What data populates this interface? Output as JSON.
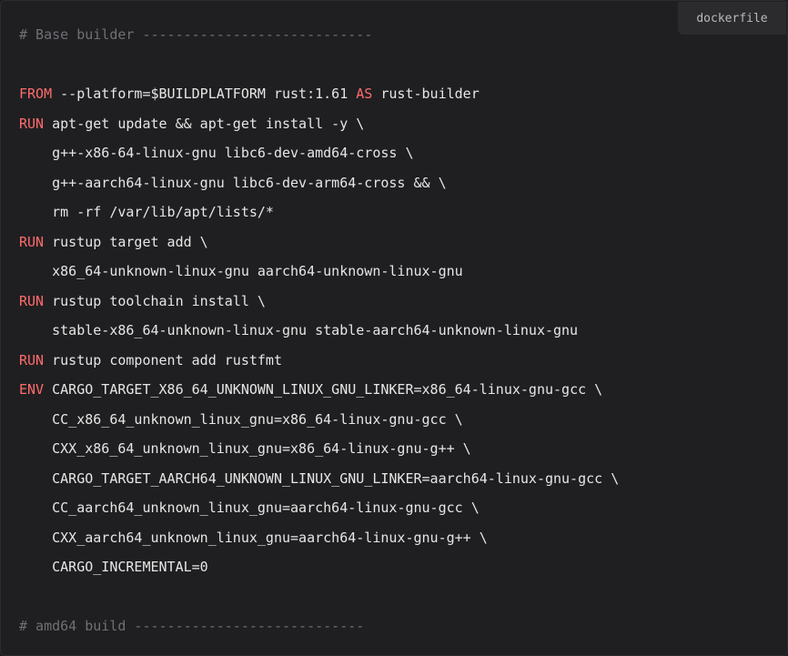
{
  "badge": {
    "language": "dockerfile"
  },
  "code": {
    "lines": [
      {
        "kw": "",
        "text": "",
        "comment": "# Base builder ----------------------------"
      },
      {
        "kw": "",
        "text": "",
        "comment": ""
      },
      {
        "kw": "FROM",
        "text": " --platform=$BUILDPLATFORM rust:1.61 ",
        "kw2": "AS",
        "text2": " rust-builder",
        "comment": ""
      },
      {
        "kw": "RUN",
        "text": " apt-get update && apt-get install -y \\",
        "comment": ""
      },
      {
        "kw": "",
        "text": "    g++-x86-64-linux-gnu libc6-dev-amd64-cross \\",
        "comment": ""
      },
      {
        "kw": "",
        "text": "    g++-aarch64-linux-gnu libc6-dev-arm64-cross && \\",
        "comment": ""
      },
      {
        "kw": "",
        "text": "    rm -rf /var/lib/apt/lists/*",
        "comment": ""
      },
      {
        "kw": "RUN",
        "text": " rustup target add \\",
        "comment": ""
      },
      {
        "kw": "",
        "text": "    x86_64-unknown-linux-gnu aarch64-unknown-linux-gnu",
        "comment": ""
      },
      {
        "kw": "RUN",
        "text": " rustup toolchain install \\",
        "comment": ""
      },
      {
        "kw": "",
        "text": "    stable-x86_64-unknown-linux-gnu stable-aarch64-unknown-linux-gnu",
        "comment": ""
      },
      {
        "kw": "RUN",
        "text": " rustup component add rustfmt",
        "comment": ""
      },
      {
        "kw": "ENV",
        "text": " CARGO_TARGET_X86_64_UNKNOWN_LINUX_GNU_LINKER=x86_64-linux-gnu-gcc \\",
        "comment": ""
      },
      {
        "kw": "",
        "text": "    CC_x86_64_unknown_linux_gnu=x86_64-linux-gnu-gcc \\",
        "comment": ""
      },
      {
        "kw": "",
        "text": "    CXX_x86_64_unknown_linux_gnu=x86_64-linux-gnu-g++ \\",
        "comment": ""
      },
      {
        "kw": "",
        "text": "    CARGO_TARGET_AARCH64_UNKNOWN_LINUX_GNU_LINKER=aarch64-linux-gnu-gcc \\",
        "comment": ""
      },
      {
        "kw": "",
        "text": "    CC_aarch64_unknown_linux_gnu=aarch64-linux-gnu-gcc \\",
        "comment": ""
      },
      {
        "kw": "",
        "text": "    CXX_aarch64_unknown_linux_gnu=aarch64-linux-gnu-g++ \\",
        "comment": ""
      },
      {
        "kw": "",
        "text": "    CARGO_INCREMENTAL=0",
        "comment": ""
      },
      {
        "kw": "",
        "text": "",
        "comment": ""
      },
      {
        "kw": "",
        "text": "",
        "comment": "# amd64 build ----------------------------"
      }
    ]
  },
  "colors": {
    "background": "#1f1f21",
    "keyword": "#ff6b6b",
    "comment": "#6f6f75",
    "text": "#e6e6e6",
    "badge_bg": "#2b2b2e"
  }
}
